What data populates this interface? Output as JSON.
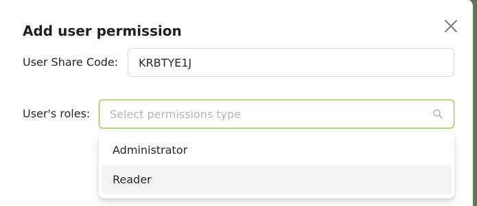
{
  "dialog": {
    "title": "Add user permission"
  },
  "form": {
    "share_code_label": "User Share Code:",
    "share_code_value": "KRBTYE1J",
    "roles_label": "User's roles:",
    "roles_placeholder": "Select permissions type"
  },
  "dropdown": {
    "options": [
      {
        "label": "Administrator"
      },
      {
        "label": "Reader"
      }
    ]
  },
  "icons": {
    "close": "close-icon",
    "search": "search-icon"
  },
  "colors": {
    "accent": "#8cc14a",
    "primary_button": "#4e8a2e"
  }
}
